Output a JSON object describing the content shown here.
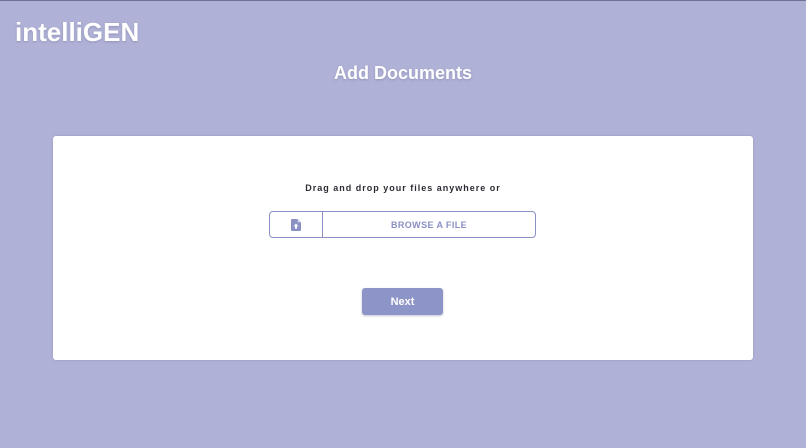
{
  "header": {
    "logo_text": "intelliGEN",
    "page_title": "Add Documents"
  },
  "upload": {
    "instruction": "Drag and drop your files anywhere or",
    "browse_label": "BROWSE A FILE",
    "browse_icon": "file-upload-icon"
  },
  "actions": {
    "next_label": "Next"
  },
  "colors": {
    "background": "#afb1d6",
    "accent": "#8a90c4",
    "button": "#8d94c7",
    "card": "#ffffff"
  }
}
